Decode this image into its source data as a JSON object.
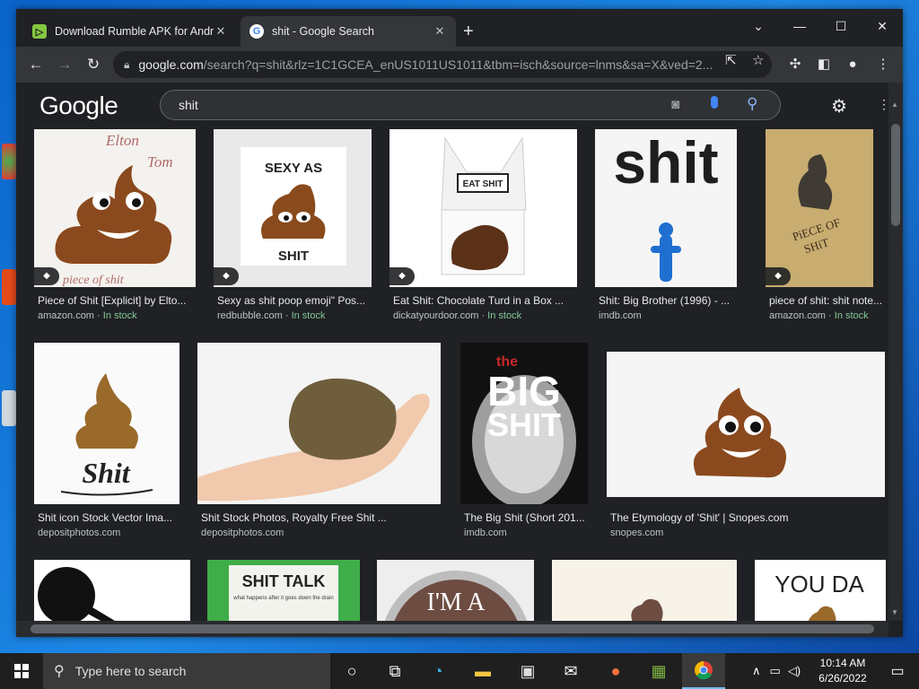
{
  "browser": {
    "tabs": [
      {
        "title": "Download Rumble APK for Android",
        "favicon": "rumble-icon"
      },
      {
        "title": "shit - Google Search",
        "favicon": "google-icon"
      }
    ],
    "url_host": "google.com",
    "url_path": "/search?q=shit&rlz=1C1GCEA_enUS1011US1011&tbm=isch&source=lnms&sa=X&ved=2..."
  },
  "google": {
    "logo": "Google",
    "query": "shit"
  },
  "results": [
    {
      "caption": "Piece of Shit [Explicit] by Elto...",
      "source": "amazon.com",
      "stock": "In stock"
    },
    {
      "caption": "Sexy as shit poop emoji\" Pos...",
      "source": "redbubble.com",
      "stock": "In stock"
    },
    {
      "caption": "Eat Shit: Chocolate Turd in a Box ...",
      "source": "dickatyourdoor.com",
      "stock": "In stock"
    },
    {
      "caption": "Shit: Big Brother (1996) - ...",
      "source": "imdb.com",
      "stock": ""
    },
    {
      "caption": "piece of shit: shit note...",
      "source": "amazon.com",
      "stock": "In stock"
    },
    {
      "caption": "Shit icon Stock Vector Ima...",
      "source": "depositphotos.com",
      "stock": ""
    },
    {
      "caption": "Shit Stock Photos, Royalty Free Shit ...",
      "source": "depositphotos.com",
      "stock": ""
    },
    {
      "caption": "The Big Shit (Short 201...",
      "source": "imdb.com",
      "stock": ""
    },
    {
      "caption": "The Etymology of 'Shit' | Snopes.com",
      "source": "snopes.com",
      "stock": ""
    }
  ],
  "image_text": {
    "elton_line1": "Elton",
    "elton_line2": "Tom",
    "elton_bottom": "piece of shit",
    "sexy_top": "SEXY AS",
    "sexy_bottom": "SHIT",
    "eat_shit": "EAT SHIT",
    "big_brother": "shit",
    "note_line1": "PiECE OF",
    "note_line2": "SHiT",
    "shit_icon": "Shit",
    "big_the": "the",
    "big_big": "BIG",
    "big_shit": "SHIT",
    "shit_talk": "SHIT TALK",
    "shit_talk_sub": "what happens after it goes down the drain",
    "im_a": "I'M A",
    "you_da": "YOU DA"
  },
  "taskbar": {
    "search_placeholder": "Type here to search",
    "time": "10:14 AM",
    "date": "6/26/2022"
  }
}
